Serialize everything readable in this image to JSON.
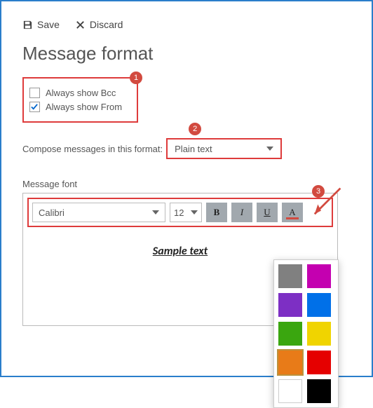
{
  "toolbar": {
    "save": "Save",
    "discard": "Discard"
  },
  "title": "Message format",
  "badges": {
    "b1": "1",
    "b2": "2",
    "b3": "3"
  },
  "options": {
    "bcc_label": "Always show Bcc",
    "bcc_checked": false,
    "from_label": "Always show From",
    "from_checked": true
  },
  "compose": {
    "label": "Compose messages in this format:",
    "value": "Plain text"
  },
  "messagefont": {
    "label": "Message font",
    "font": "Calibri",
    "size": "12",
    "sample": "Sample text"
  },
  "palette": {
    "colors": [
      {
        "name": "gray",
        "hex": "#808080",
        "selected": false
      },
      {
        "name": "magenta",
        "hex": "#c400b0",
        "selected": false
      },
      {
        "name": "purple",
        "hex": "#7d2fc4",
        "selected": false
      },
      {
        "name": "blue",
        "hex": "#0070e8",
        "selected": false
      },
      {
        "name": "green",
        "hex": "#3aa60f",
        "selected": false
      },
      {
        "name": "yellow",
        "hex": "#f0d400",
        "selected": false
      },
      {
        "name": "orange",
        "hex": "#e87b18",
        "selected": true
      },
      {
        "name": "red",
        "hex": "#e50000",
        "selected": false
      },
      {
        "name": "white",
        "hex": "#ffffff",
        "selected": false
      },
      {
        "name": "black",
        "hex": "#000000",
        "selected": false
      }
    ]
  }
}
